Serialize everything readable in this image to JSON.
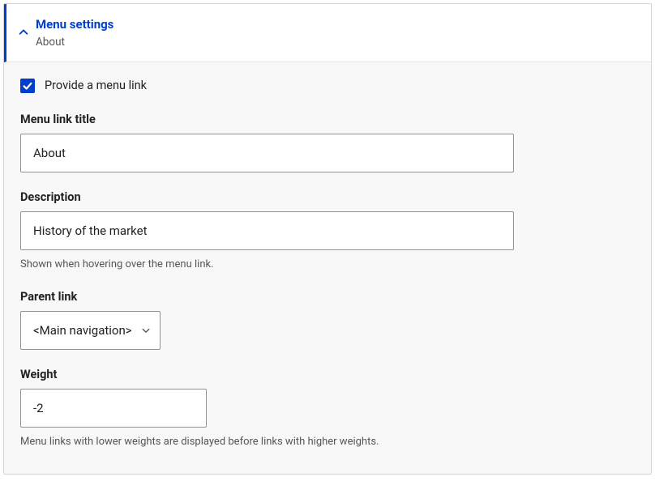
{
  "header": {
    "title": "Menu settings",
    "subtitle": "About"
  },
  "form": {
    "provide_link": {
      "label": "Provide a menu link",
      "checked": true
    },
    "menu_link_title": {
      "label": "Menu link title",
      "value": "About"
    },
    "description": {
      "label": "Description",
      "value": "History of the market",
      "help": "Shown when hovering over the menu link."
    },
    "parent_link": {
      "label": "Parent link",
      "value": "<Main navigation>"
    },
    "weight": {
      "label": "Weight",
      "value": "-2",
      "help": "Menu links with lower weights are displayed before links with higher weights."
    }
  }
}
